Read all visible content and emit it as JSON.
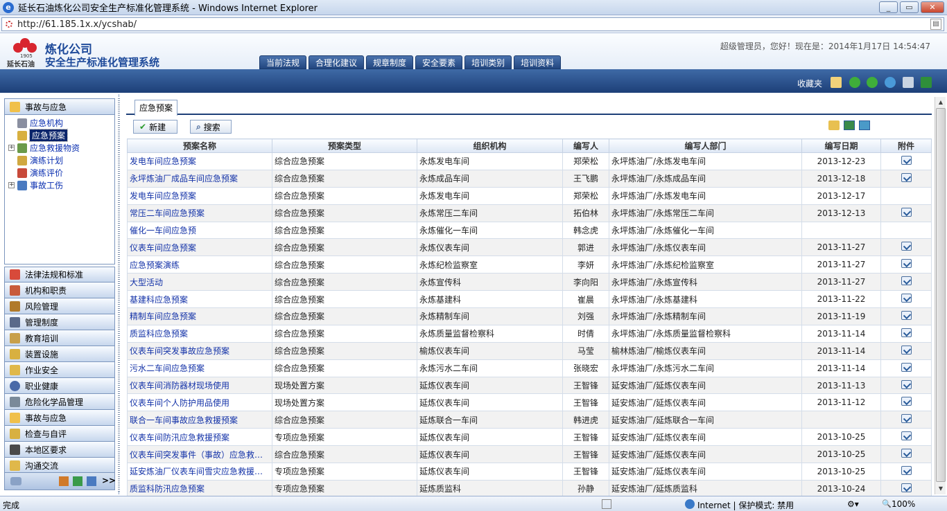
{
  "window": {
    "title": "延长石油炼化公司安全生产标准化管理系统 - Windows Internet Explorer",
    "controls": [
      "_",
      "▭",
      "✕"
    ]
  },
  "address": {
    "url": "http://61.185.1x.x/ycshab/"
  },
  "header": {
    "brand_line1": "炼化公司",
    "brand_line2": "安全生产标准化管理系统",
    "brand_sub": "延长石油",
    "logo_year": "1905",
    "welcome": "超级管理员，您好！现在是：2014年1月17日  14:54:47",
    "tabs": [
      "当前法规",
      "合理化建议",
      "规章制度",
      "安全要素",
      "培训类别",
      "培训资料"
    ],
    "favorites": "收藏夹"
  },
  "sidebar": {
    "header_label": "事故与应急",
    "tree": [
      {
        "label": "应急机构",
        "expandable": false,
        "selected": false
      },
      {
        "label": "应急预案",
        "expandable": false,
        "selected": true
      },
      {
        "label": "应急救援物资",
        "expandable": true,
        "selected": false
      },
      {
        "label": "演练计划",
        "expandable": false,
        "selected": false
      },
      {
        "label": "演练评价",
        "expandable": false,
        "selected": false
      },
      {
        "label": "事故工伤",
        "expandable": true,
        "selected": false
      }
    ],
    "menu": [
      "法律法规和标准",
      "机构和职责",
      "风险管理",
      "管理制度",
      "教育培训",
      "装置设施",
      "作业安全",
      "职业健康",
      "危险化学品管理",
      "事故与应急",
      "检查与自评",
      "本地区要求",
      "沟通交流"
    ],
    "footer": ">>"
  },
  "main": {
    "page_tab": "应急预案",
    "buttons": {
      "new": "新建",
      "search": "搜索"
    },
    "columns": [
      "预案名称",
      "预案类型",
      "组织机构",
      "编写人",
      "编写人部门",
      "编写日期",
      "附件"
    ],
    "rows": [
      {
        "name": "发电车间应急预案",
        "type": "综合应急预案",
        "org": "永炼发电车间",
        "author": "郑荣松",
        "dept": "永坪炼油厂/永炼发电车间",
        "date": "2013-12-23",
        "att": true
      },
      {
        "name": "永坪炼油厂成品车间应急预案",
        "type": "综合应急预案",
        "org": "永炼成品车间",
        "author": "王飞鹏",
        "dept": "永坪炼油厂/永炼成品车间",
        "date": "2013-12-18",
        "att": true
      },
      {
        "name": "发电车间应急预案",
        "type": "综合应急预案",
        "org": "永炼发电车间",
        "author": "郑荣松",
        "dept": "永坪炼油厂/永炼发电车间",
        "date": "2013-12-17",
        "att": false
      },
      {
        "name": "常压二车间应急预案",
        "type": "综合应急预案",
        "org": "永炼常压二车间",
        "author": "拓伯林",
        "dept": "永坪炼油厂/永炼常压二车间",
        "date": "2013-12-13",
        "att": true
      },
      {
        "name": "催化一车间应急预",
        "type": "综合应急预案",
        "org": "永炼催化一车间",
        "author": "韩念虎",
        "dept": "永坪炼油厂/永炼催化一车间",
        "date": "",
        "att": false
      },
      {
        "name": "仪表车间应急预案",
        "type": "综合应急预案",
        "org": "永炼仪表车间",
        "author": "郭进",
        "dept": "永坪炼油厂/永炼仪表车间",
        "date": "2013-11-27",
        "att": true
      },
      {
        "name": "应急预案演练",
        "type": "综合应急预案",
        "org": "永炼纪检监察室",
        "author": "李妍",
        "dept": "永坪炼油厂/永炼纪检监察室",
        "date": "2013-11-27",
        "att": true
      },
      {
        "name": "大型活动",
        "type": "综合应急预案",
        "org": "永炼宣传科",
        "author": "李向阳",
        "dept": "永坪炼油厂/永炼宣传科",
        "date": "2013-11-27",
        "att": true
      },
      {
        "name": "基建科应急预案",
        "type": "综合应急预案",
        "org": "永炼基建科",
        "author": "崔晨",
        "dept": "永坪炼油厂/永炼基建科",
        "date": "2013-11-22",
        "att": true
      },
      {
        "name": "精制车间应急预案",
        "type": "综合应急预案",
        "org": "永炼精制车间",
        "author": "刘强",
        "dept": "永坪炼油厂/永炼精制车间",
        "date": "2013-11-19",
        "att": true
      },
      {
        "name": "质监科应急预案",
        "type": "综合应急预案",
        "org": "永炼质量监督检察科",
        "author": "时倩",
        "dept": "永坪炼油厂/永炼质量监督检察科",
        "date": "2013-11-14",
        "att": true
      },
      {
        "name": "仪表车间突发事故应急预案",
        "type": "综合应急预案",
        "org": "榆炼仪表车间",
        "author": "马莹",
        "dept": "榆林炼油厂/榆炼仪表车间",
        "date": "2013-11-14",
        "att": true
      },
      {
        "name": "污水二车间应急预案",
        "type": "综合应急预案",
        "org": "永炼污水二车间",
        "author": "张晓宏",
        "dept": "永坪炼油厂/永炼污水二车间",
        "date": "2013-11-14",
        "att": true
      },
      {
        "name": "仪表车间消防器材现场使用",
        "type": "现场处置方案",
        "org": "延炼仪表车间",
        "author": "王智锋",
        "dept": "延安炼油厂/延炼仪表车间",
        "date": "2013-11-13",
        "att": true
      },
      {
        "name": "仪表车间个人防护用品使用",
        "type": "现场处置方案",
        "org": "延炼仪表车间",
        "author": "王智锋",
        "dept": "延安炼油厂/延炼仪表车间",
        "date": "2013-11-12",
        "att": true
      },
      {
        "name": "联合一车间事故应急救援预案",
        "type": "综合应急预案",
        "org": "延炼联合一车间",
        "author": "韩进虎",
        "dept": "延安炼油厂/延炼联合一车间",
        "date": "",
        "att": true
      },
      {
        "name": "仪表车间防汛应急救援预案",
        "type": "专项应急预案",
        "org": "延炼仪表车间",
        "author": "王智锋",
        "dept": "延安炼油厂/延炼仪表车间",
        "date": "2013-10-25",
        "att": true
      },
      {
        "name": "仪表车间突发事件（事故）应急救…",
        "type": "综合应急预案",
        "org": "延炼仪表车间",
        "author": "王智锋",
        "dept": "延安炼油厂/延炼仪表车间",
        "date": "2013-10-25",
        "att": true
      },
      {
        "name": "延安炼油厂仪表车间雪灾应急救援…",
        "type": "专项应急预案",
        "org": "延炼仪表车间",
        "author": "王智锋",
        "dept": "延安炼油厂/延炼仪表车间",
        "date": "2013-10-25",
        "att": true
      },
      {
        "name": "质监科防汛应急预案",
        "type": "专项应急预案",
        "org": "延炼质监科",
        "author": "孙静",
        "dept": "延安炼油厂/延炼质监科",
        "date": "2013-10-24",
        "att": true
      }
    ]
  },
  "status": {
    "left": "完成",
    "zone": "Internet | 保护模式: 禁用",
    "zoom": "100%"
  },
  "colors": {
    "nav_blue": "#1d3f78",
    "link": "#1433a8",
    "brand": "#1e4a9a",
    "logo_red": "#d8262f"
  }
}
